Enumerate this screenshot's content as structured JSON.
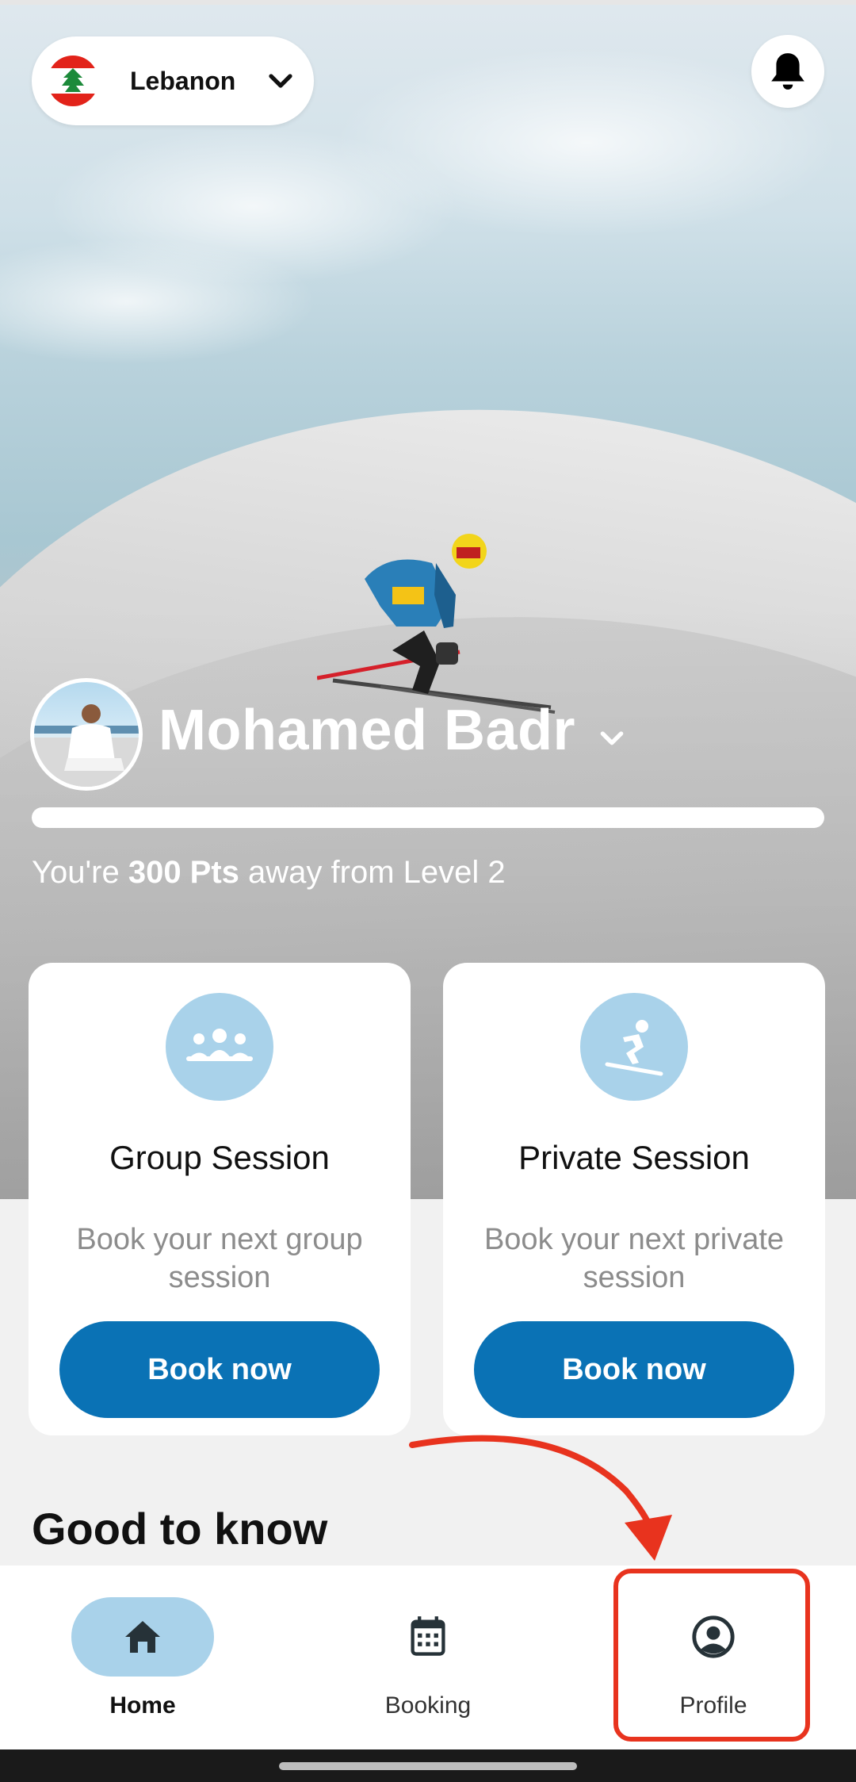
{
  "header": {
    "country": "Lebanon",
    "country_flag_icon": "lebanon-flag-icon",
    "notifications_icon": "bell-icon"
  },
  "profile": {
    "name": "Mohamed Badr",
    "progress_fraction": 1.0,
    "level_prefix": "You're ",
    "points": "300 Pts",
    "level_suffix": " away from Level 2"
  },
  "cards": [
    {
      "title": "Group Session",
      "description": "Book your next group session",
      "button": "Book now",
      "icon": "group-icon"
    },
    {
      "title": "Private Session",
      "description": "Book your next private session",
      "button": "Book now",
      "icon": "skier-icon"
    }
  ],
  "section": {
    "title": "Good to know"
  },
  "nav": {
    "items": [
      {
        "label": "Home",
        "icon": "home-icon",
        "active": true
      },
      {
        "label": "Booking",
        "icon": "calendar-icon",
        "active": false
      },
      {
        "label": "Profile",
        "icon": "user-circle-icon",
        "active": false
      }
    ]
  },
  "colors": {
    "primary": "#0a72b5",
    "accent_light": "#a9d2ea",
    "annotation": "#e8331e"
  }
}
